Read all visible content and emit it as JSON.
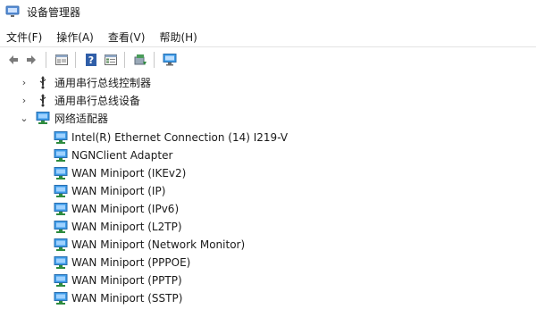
{
  "window": {
    "title": "设备管理器"
  },
  "menu": [
    "文件(F)",
    "操作(A)",
    "查看(V)",
    "帮助(H)"
  ],
  "toolbar": {
    "buttons": [
      {
        "name": "back-arrow-icon"
      },
      {
        "name": "forward-arrow-icon"
      },
      {
        "name": "properties-icon"
      },
      {
        "name": "help-icon"
      },
      {
        "name": "details-view-icon"
      },
      {
        "name": "update-driver-icon"
      },
      {
        "name": "scan-hardware-icon"
      }
    ]
  },
  "tree": {
    "categories": [
      {
        "label": "通用串行总线控制器",
        "expanded": false,
        "icon": "usb-icon"
      },
      {
        "label": "通用串行总线设备",
        "expanded": false,
        "icon": "usb-icon"
      },
      {
        "label": "网络适配器",
        "expanded": true,
        "icon": "network-adapter-icon"
      }
    ],
    "devices": [
      "Intel(R) Ethernet Connection (14) I219-V",
      "NGNClient Adapter",
      "WAN Miniport (IKEv2)",
      "WAN Miniport (IP)",
      "WAN Miniport (IPv6)",
      "WAN Miniport (L2TP)",
      "WAN Miniport (Network Monitor)",
      "WAN Miniport (PPPOE)",
      "WAN Miniport (PPTP)",
      "WAN Miniport (SSTP)"
    ]
  },
  "colors": {
    "accent": "#2a7fd4",
    "monitor_screen": "#3c9be8",
    "monitor_stand": "#2e8b3e",
    "usb": "#333333"
  }
}
